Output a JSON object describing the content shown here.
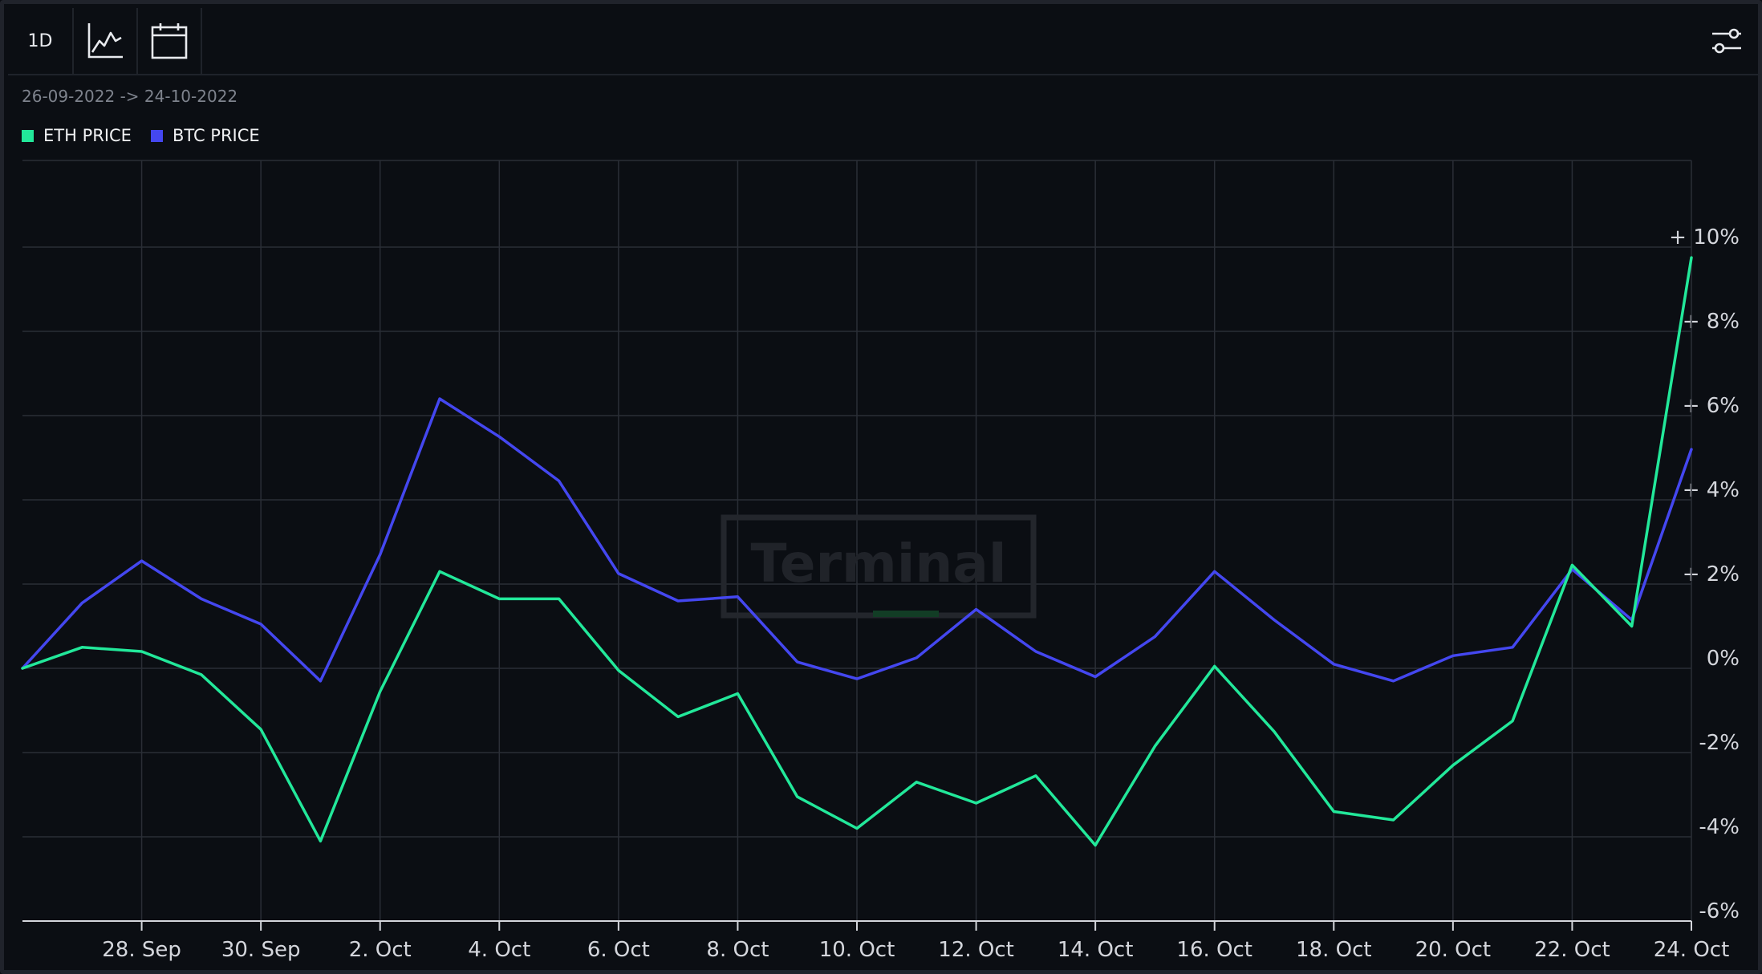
{
  "toolbar": {
    "interval_label": "1D",
    "chart_type_icon": "line-chart-icon",
    "calendar_icon": "calendar-icon",
    "settings_icon": "sliders-icon"
  },
  "date_range": "26-09-2022 -> 24-10-2022",
  "watermark": "Terminal",
  "colors": {
    "eth": "#22e89a",
    "btc": "#4447f0",
    "background": "#0b0e13",
    "grid": "#2a2e36"
  },
  "chart_data": {
    "type": "line",
    "x": [
      "26-09-2022",
      "27-09-2022",
      "28-09-2022",
      "29-09-2022",
      "30-09-2022",
      "01-10-2022",
      "02-10-2022",
      "03-10-2022",
      "04-10-2022",
      "05-10-2022",
      "06-10-2022",
      "07-10-2022",
      "08-10-2022",
      "09-10-2022",
      "10-10-2022",
      "11-10-2022",
      "12-10-2022",
      "13-10-2022",
      "14-10-2022",
      "15-10-2022",
      "16-10-2022",
      "17-10-2022",
      "18-10-2022",
      "19-10-2022",
      "20-10-2022",
      "21-10-2022",
      "22-10-2022",
      "23-10-2022",
      "24-10-2022"
    ],
    "x_tick_labels": [
      "28. Sep",
      "30. Sep",
      "2. Oct",
      "4. Oct",
      "6. Oct",
      "8. Oct",
      "10. Oct",
      "12. Oct",
      "14. Oct",
      "16. Oct",
      "18. Oct",
      "20. Oct",
      "22. Oct",
      "24. Oct"
    ],
    "x_tick_indices": [
      2,
      4,
      6,
      8,
      10,
      12,
      14,
      16,
      18,
      20,
      22,
      24,
      26,
      28
    ],
    "y_ticks": [
      10,
      8,
      6,
      4,
      2,
      0,
      -2,
      -4,
      -6
    ],
    "y_tick_labels": [
      "+ 10%",
      "+ 8%",
      "+ 6%",
      "+ 4%",
      "+ 2%",
      "0%",
      "-2%",
      "-4%",
      "-6%"
    ],
    "ylim": [
      -6,
      10
    ],
    "grid": true,
    "legend_position": "top-left",
    "series": [
      {
        "name": "ETH PRICE",
        "color": "#22e89a",
        "values": [
          0.0,
          0.5,
          0.4,
          -0.15,
          -1.45,
          -4.1,
          -0.55,
          2.3,
          1.65,
          1.65,
          -0.05,
          -1.15,
          -0.6,
          -3.05,
          -3.8,
          -2.7,
          -3.2,
          -2.55,
          -4.2,
          -1.85,
          0.05,
          -1.5,
          -3.4,
          -3.6,
          -2.3,
          -1.25,
          2.45,
          1.0,
          9.75
        ]
      },
      {
        "name": "BTC PRICE",
        "color": "#4447f0",
        "values": [
          0.0,
          1.55,
          2.55,
          1.65,
          1.05,
          -0.3,
          2.7,
          6.4,
          5.5,
          4.45,
          2.25,
          1.6,
          1.7,
          0.15,
          -0.25,
          0.25,
          1.4,
          0.4,
          -0.2,
          0.75,
          2.3,
          1.15,
          0.1,
          -0.3,
          0.3,
          0.5,
          2.35,
          1.15,
          5.2
        ]
      }
    ]
  }
}
